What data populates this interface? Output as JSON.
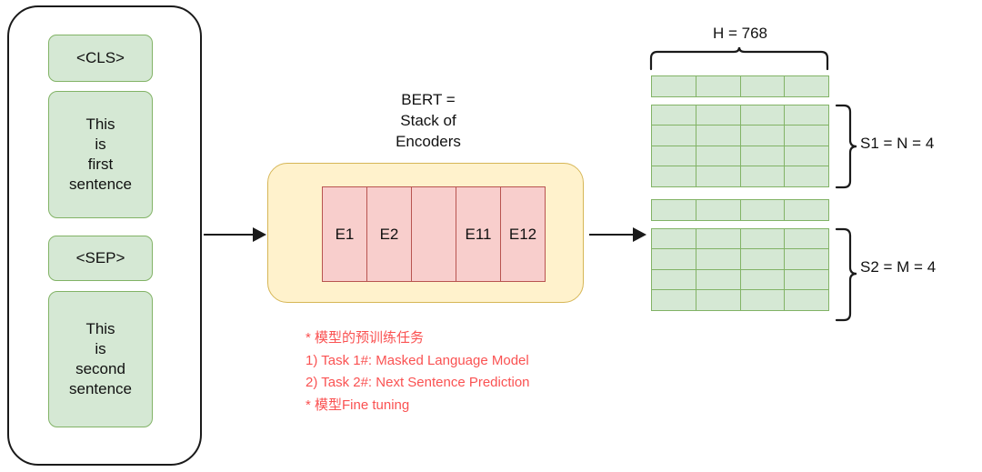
{
  "diagram": {
    "title": "BERT input/output representation diagram"
  },
  "input_panel": {
    "name": "input-sequence-panel",
    "tokens": [
      {
        "id": "cls",
        "label": "<CLS>",
        "kind": "special"
      },
      {
        "id": "sent1",
        "label": "This\nis\nfirst\nsentence",
        "kind": "sentence"
      },
      {
        "id": "sep",
        "label": "<SEP>",
        "kind": "special"
      },
      {
        "id": "sent2",
        "label": "This\nis\nsecond\nsentence",
        "kind": "sentence"
      }
    ]
  },
  "bert": {
    "title_lines": [
      "BERT =",
      "Stack of",
      "Encoders"
    ],
    "title": "BERT = Stack of Encoders",
    "encoders": [
      {
        "label": "E1"
      },
      {
        "label": "E2"
      },
      {
        "label": ""
      },
      {
        "label": "E11"
      },
      {
        "label": "E12"
      }
    ]
  },
  "notes": {
    "lines": [
      "* 模型的预训练任务",
      "1) Task 1#: Masked Language Model",
      "2) Task 2#: Next Sentence Prediction",
      "* 模型Fine tuning"
    ]
  },
  "output_matrix": {
    "hidden_label": "H = 768",
    "hidden_size": 768,
    "columns": 4,
    "groups": [
      {
        "id": "cls",
        "rows": 1,
        "label": ""
      },
      {
        "id": "s1",
        "rows": 4,
        "label": "S1 = N = 4"
      },
      {
        "id": "sep",
        "rows": 1,
        "label": ""
      },
      {
        "id": "s2",
        "rows": 4,
        "label": "S2 = M = 4"
      }
    ],
    "s1_label": "S1 = N = 4",
    "s2_label": "S2 = M = 4"
  },
  "colors": {
    "green_fill": "#d5e8d4",
    "green_stroke": "#82b366",
    "yellow_fill": "#fff2cc",
    "yellow_stroke": "#d6b656",
    "pink_fill": "#f8cecc",
    "pink_stroke": "#b85450",
    "red_text": "#fa5252",
    "outline": "#1a1a1a"
  }
}
